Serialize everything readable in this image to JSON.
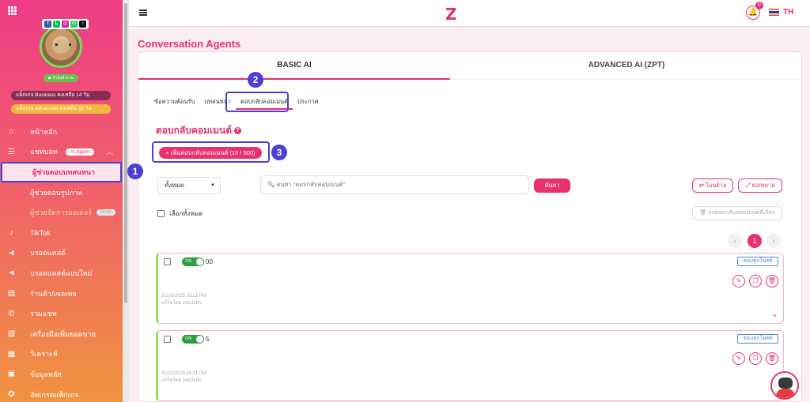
{
  "sidebar": {
    "package_business": "แพ็กเกจ Business คงเหลือ 14 วัน",
    "package_advanced": "แพ็กเกจ Advanced คงเหลือ 32 วัน",
    "profile_button": "▶ กำลังทำงาน",
    "items": [
      {
        "label": "หน้าหลัก",
        "icon": "home-icon",
        "glyph": "⌂"
      },
      {
        "label": "แชทบอท",
        "icon": "chat-icon",
        "glyph": "☰",
        "tag": "Ai Agent"
      },
      {
        "label": "ผู้ช่วยตอบบทสนทนา"
      },
      {
        "label": "ผู้ช่วยตอบรูปภาพ"
      },
      {
        "label": "ผู้ช่วยจัดการออเดอร์",
        "badge": "Soon"
      },
      {
        "label": "TikTok",
        "icon": "tiktok-icon",
        "glyph": "♪"
      },
      {
        "label": "บรอดแคสต์",
        "icon": "megaphone-icon",
        "glyph": "◄"
      },
      {
        "label": "บรอดแคสต์แบบใหม่",
        "icon": "megaphone-new-icon",
        "glyph": "◄"
      },
      {
        "label": "ร้านค้า/เซลเพจ",
        "icon": "store-icon",
        "glyph": "▤"
      },
      {
        "label": "รวมแชท",
        "icon": "chats-icon",
        "glyph": "✆"
      },
      {
        "label": "เครื่องมือเพิ่มยอดขาย",
        "icon": "tools-icon",
        "glyph": "▥"
      },
      {
        "label": "วิเคราะห์",
        "icon": "analytics-icon",
        "glyph": "▦"
      },
      {
        "label": "ข้อมูลหลัก",
        "icon": "data-icon",
        "glyph": "▣"
      },
      {
        "label": "อัพเกรดแพ็กเกจ",
        "icon": "upgrade-icon",
        "glyph": "✪"
      }
    ]
  },
  "topbar": {
    "logo": "Z",
    "notification_count": "0",
    "language": "TH"
  },
  "page": {
    "title": "Conversation Agents",
    "tabs": [
      "BASIC AI",
      "ADVANCED AI (ZPT)"
    ],
    "subtabs": [
      "ข้อความต้อนรับ",
      "บทสนทนา",
      "ตอบกลับคอมเมนต์",
      "ประกาศ"
    ],
    "section_title": "ตอบกลับคอมเมนต์",
    "add_button": "+ เพิ่มตอบกลับคอมเมนต์ (15 / 500)",
    "filter_value": "ทั้งหมด",
    "search_placeholder": "คนหา \"ตอบกลับคอมเมนต์\"",
    "search_button": "ค้นหา",
    "move_button": "⇄ โอนย้าย",
    "expand_button": "⤢ ย่อ/ขยาย",
    "select_all": "เลือกทั้งหมด",
    "delete_selected": "🗑 ลบตอบกลับคอมเมนต์ที่เลือก",
    "pagination": {
      "prev": "‹",
      "current": "1",
      "next": "›"
    }
  },
  "steps": [
    "1",
    "2",
    "3"
  ],
  "items": [
    {
      "toggle": "ON",
      "name": "00",
      "type": "ตอบทุกโพสต์",
      "date": "31/10/2025 03:11 PM",
      "author": "แก้ไขโดย zwizfahh"
    },
    {
      "toggle": "ON",
      "name": "5",
      "type": "ตอบทุกโพสต์",
      "date": "31/10/2025 03:11 PM",
      "author": "แก้ไขโดย zwizfahh"
    }
  ],
  "colors": {
    "brand": "#e8316f",
    "highlight": "#4b3fd6",
    "active_green": "#2e9e3f"
  }
}
